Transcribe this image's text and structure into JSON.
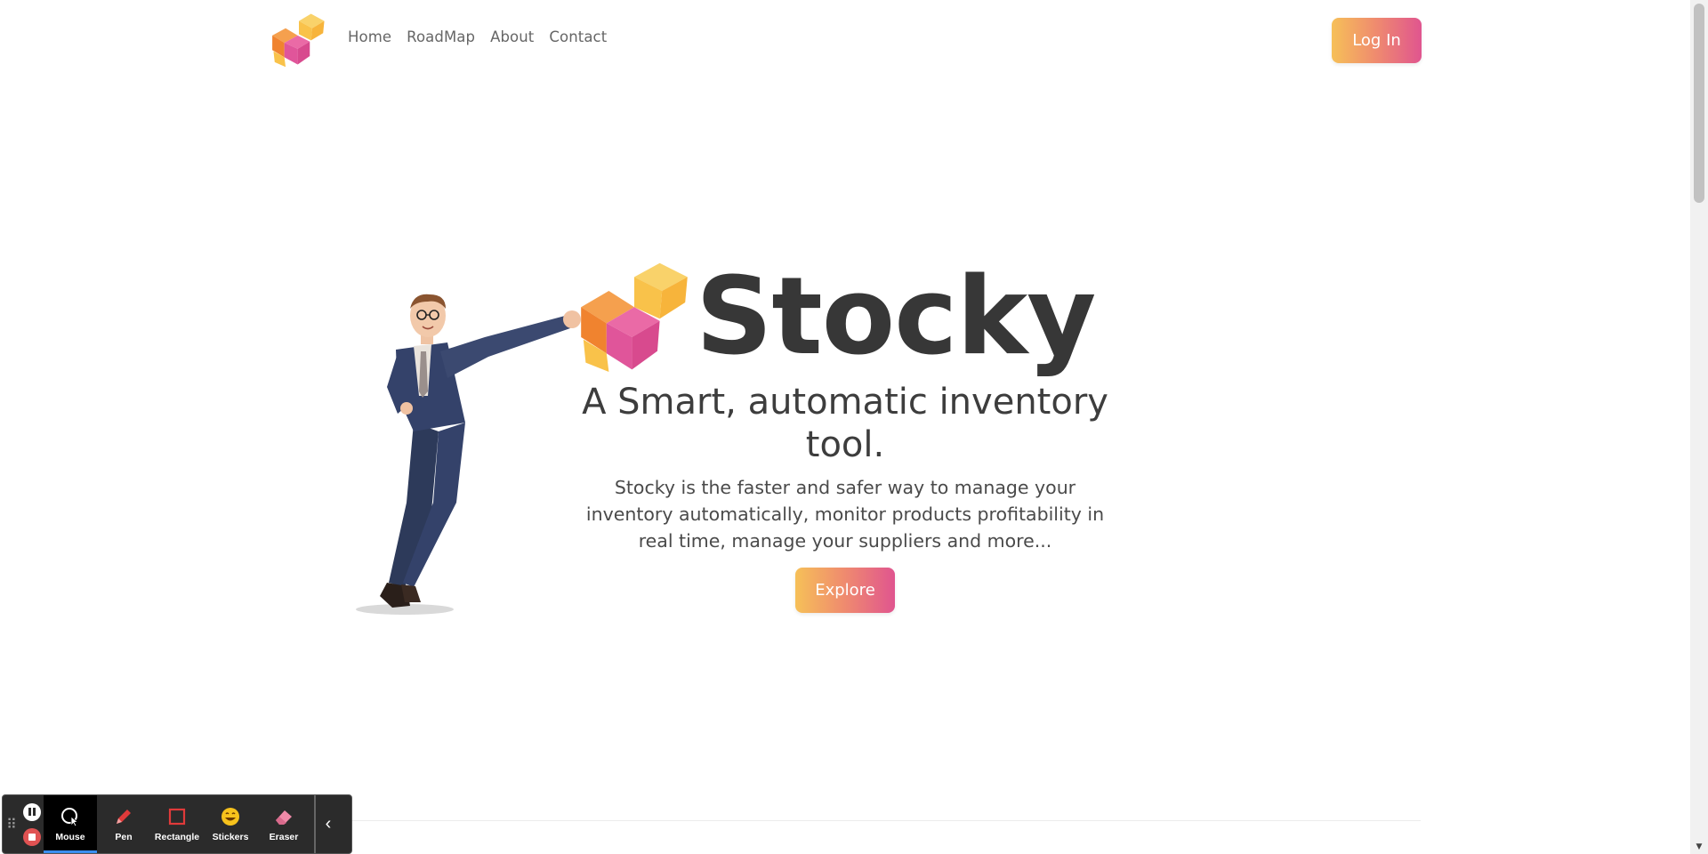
{
  "header": {
    "nav": [
      "Home",
      "RoadMap",
      "About",
      "Contact"
    ],
    "login_label": "Log In"
  },
  "hero": {
    "title": "Stocky",
    "subtitle": "A Smart, automatic inventory tool.",
    "description": "Stocky is the faster and safer way to manage your inventory automatically, monitor products profitability in real time, manage your suppliers and more...",
    "explore_label": "Explore"
  },
  "recorder": {
    "tools": [
      {
        "label": "Mouse",
        "icon": "mouse-cursor-icon",
        "active": true
      },
      {
        "label": "Pen",
        "icon": "pen-icon",
        "active": false
      },
      {
        "label": "Rectangle",
        "icon": "rectangle-icon",
        "active": false
      },
      {
        "label": "Stickers",
        "icon": "sticker-icon",
        "active": false
      },
      {
        "label": "Eraser",
        "icon": "eraser-icon",
        "active": false
      }
    ]
  },
  "colors": {
    "gradient_start": "#f6c058",
    "gradient_end": "#e0558f",
    "cube_orange": "#f0832f",
    "cube_yellow": "#f9c24a",
    "cube_pink": "#e0559a",
    "title_color": "#373737"
  }
}
